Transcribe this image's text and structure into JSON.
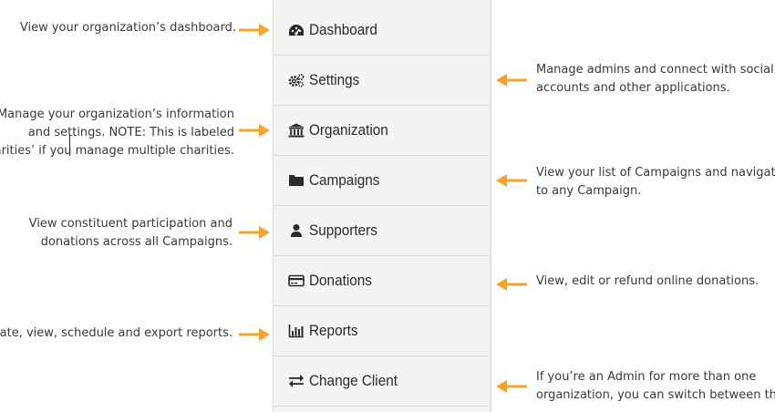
{
  "nav": {
    "items": [
      {
        "label": "Dashboard",
        "icon": "dashboard-gauge-icon"
      },
      {
        "label": "Settings",
        "icon": "gears-icon"
      },
      {
        "label": "Organization",
        "icon": "building-columns-icon"
      },
      {
        "label": "Campaigns",
        "icon": "folder-icon"
      },
      {
        "label": "Supporters",
        "icon": "user-icon"
      },
      {
        "label": "Donations",
        "icon": "credit-card-icon"
      },
      {
        "label": "Reports",
        "icon": "bar-chart-icon"
      },
      {
        "label": "Change Client",
        "icon": "exchange-arrows-icon"
      }
    ]
  },
  "descriptions": {
    "dashboard": [
      "View your organization’s dashboard."
    ],
    "settings": [
      "Manage admins and connect with social",
      "accounts and other applications."
    ],
    "organization": [
      "Manage your organization’s information",
      "and settings. NOTE: This is labeled",
      "‘Charities’ if you manage multiple charities."
    ],
    "campaigns": [
      "View your list of Campaigns and navigate",
      "to any Campaign."
    ],
    "supporters": [
      "View constituent participation and",
      "donations across all Campaigns."
    ],
    "donations": [
      "View, edit or refund online donations."
    ],
    "reports": [
      "Create, view, schedule and export reports."
    ],
    "change_client": [
      "If you’re an Admin for more than one",
      "organization, you can switch between them."
    ]
  },
  "colors": {
    "arrow": "#f5a52a",
    "sidebar_bg": "#f4f4f4",
    "text": "#3a3a3a"
  }
}
